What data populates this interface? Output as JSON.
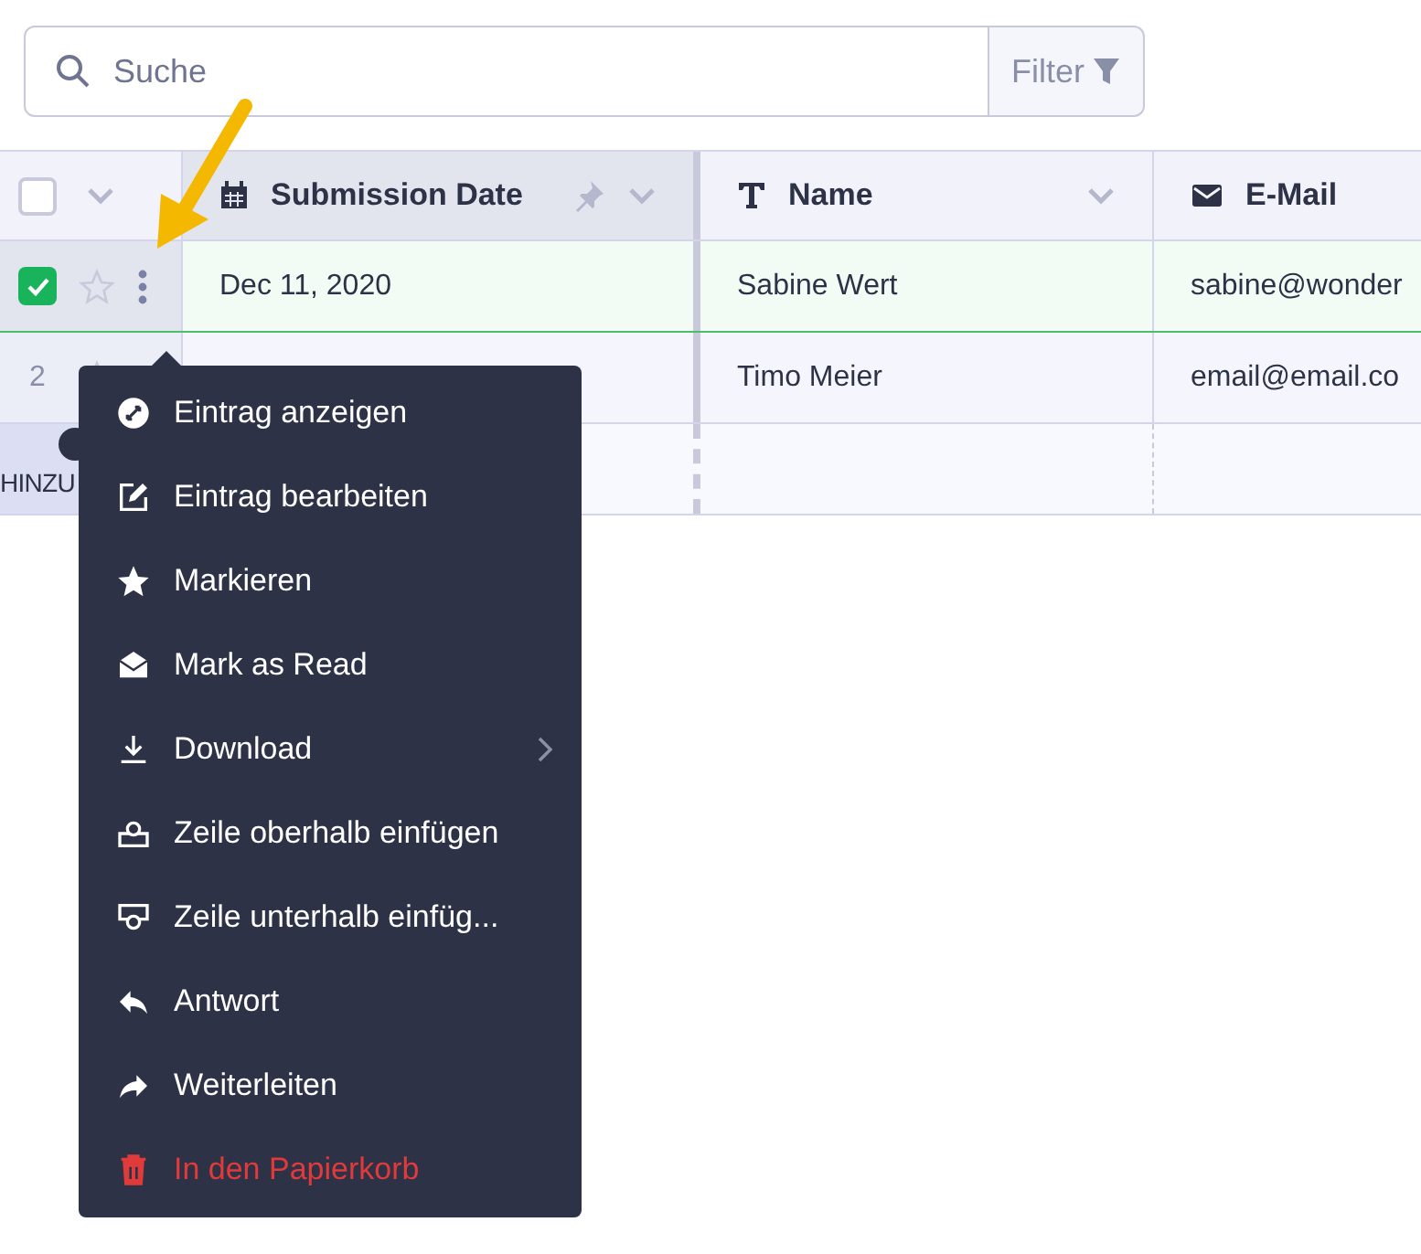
{
  "search": {
    "placeholder": "Suche"
  },
  "filter_button": {
    "label": "Filter"
  },
  "select_all": {
    "checked": false
  },
  "table": {
    "columns": [
      {
        "label": "Submission Date",
        "kind": "date",
        "pinned": false
      },
      {
        "label": "Name",
        "kind": "text"
      },
      {
        "label": "E-Mail",
        "kind": "email"
      }
    ],
    "rows": [
      {
        "checked": true,
        "starred": false,
        "number": "",
        "cells": [
          "Dec 11, 2020",
          "Sabine Wert",
          "sabine@wonder"
        ]
      },
      {
        "checked": false,
        "starred": false,
        "number": "2",
        "cells": [
          "",
          "Timo Meier",
          "email@email.co"
        ]
      }
    ],
    "add_row": {
      "label": "HINZU"
    }
  },
  "context_menu": {
    "items": [
      {
        "label": "Eintrag anzeigen",
        "kind": "expand",
        "danger": false,
        "submenu": false
      },
      {
        "label": "Eintrag bearbeiten",
        "kind": "edit",
        "danger": false,
        "submenu": false
      },
      {
        "label": "Markieren",
        "kind": "star",
        "danger": false,
        "submenu": false
      },
      {
        "label": "Mark as Read",
        "kind": "read",
        "danger": false,
        "submenu": false
      },
      {
        "label": "Download",
        "kind": "download",
        "danger": false,
        "submenu": true
      },
      {
        "label": "Zeile oberhalb einfügen",
        "kind": "insert_above",
        "danger": false,
        "submenu": false
      },
      {
        "label": "Zeile unterhalb einfüg...",
        "kind": "insert_below",
        "danger": false,
        "submenu": false
      },
      {
        "label": "Antwort",
        "kind": "reply",
        "danger": false,
        "submenu": false
      },
      {
        "label": "Weiterleiten",
        "kind": "forward",
        "danger": false,
        "submenu": false
      },
      {
        "label": "In den Papierkorb",
        "kind": "trash",
        "danger": true,
        "submenu": false
      }
    ]
  }
}
